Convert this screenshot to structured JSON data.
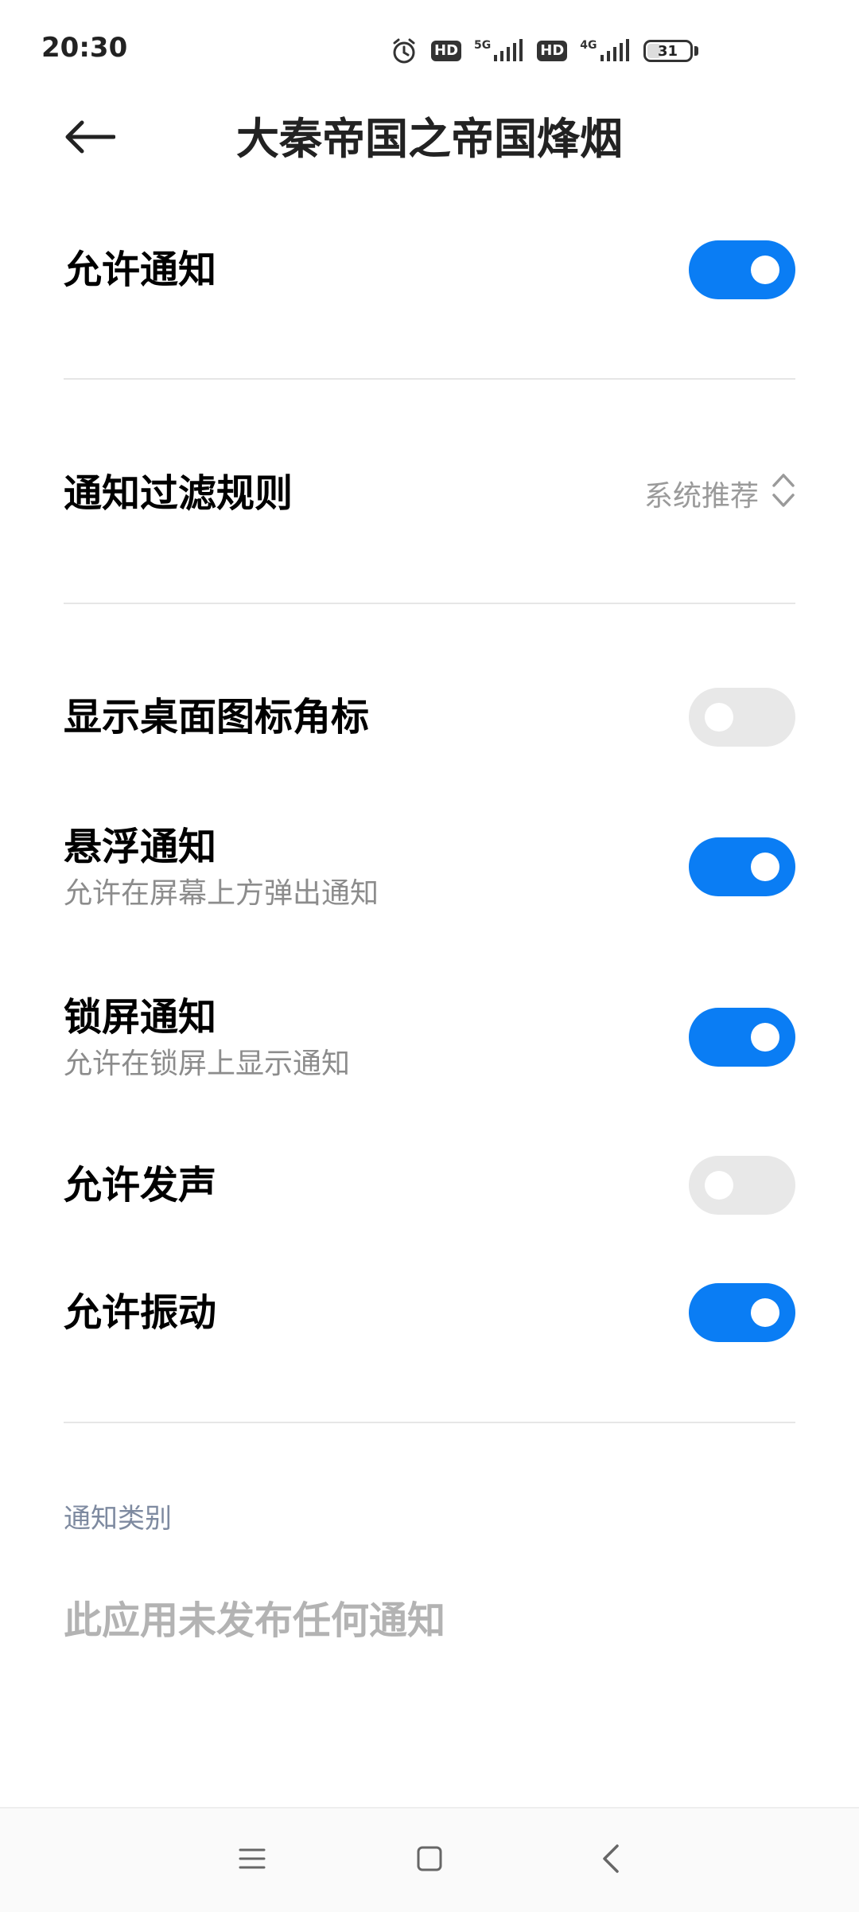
{
  "status_bar": {
    "time": "20:30",
    "net1": "5G",
    "net2": "4G",
    "hd1": "HD",
    "hd2": "HD",
    "battery_level": "31"
  },
  "header": {
    "title": "大秦帝国之帝国烽烟"
  },
  "settings": {
    "allow_notifications": {
      "label": "允许通知",
      "enabled": true
    },
    "filter_rule": {
      "label": "通知过滤规则",
      "value": "系统推荐"
    },
    "badge_icon": {
      "label": "显示桌面图标角标",
      "enabled": false
    },
    "floating": {
      "label": "悬浮通知",
      "description": "允许在屏幕上方弹出通知",
      "enabled": true
    },
    "lock_screen": {
      "label": "锁屏通知",
      "description": "允许在锁屏上显示通知",
      "enabled": true
    },
    "sound": {
      "label": "允许发声",
      "enabled": false
    },
    "vibration": {
      "label": "允许振动",
      "enabled": true
    }
  },
  "categories": {
    "header": "通知类别",
    "empty_message": "此应用未发布任何通知"
  },
  "colors": {
    "accent": "#0a7df4",
    "toggle_off": "#e8e8e8"
  },
  "icons": {
    "back": "arrow-left-icon",
    "filter_select": "chevron-up-down-icon",
    "nav_menu": "menu-icon",
    "nav_home": "square-icon",
    "nav_back": "chevron-left-icon"
  }
}
